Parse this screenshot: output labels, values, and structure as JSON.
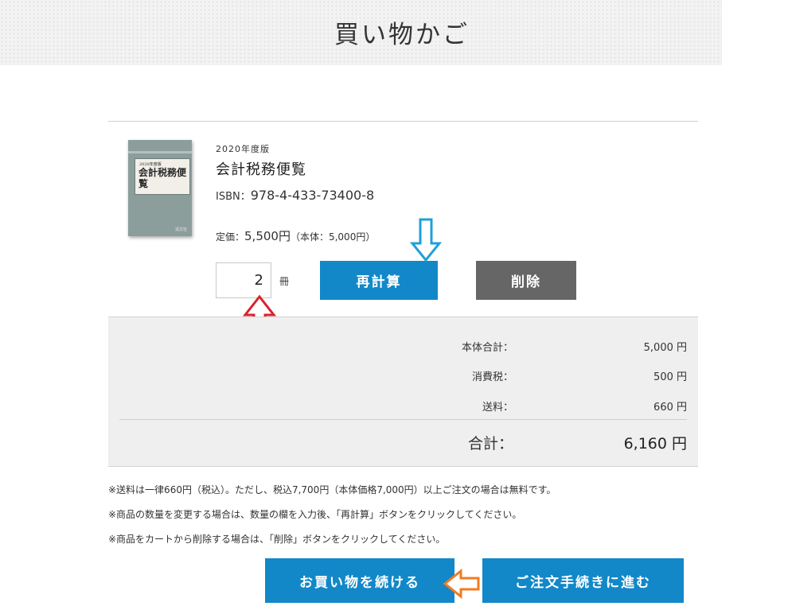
{
  "header": {
    "title": "買い物かご"
  },
  "item": {
    "cover": {
      "edition": "2020年度版",
      "title": "会計税務便覧",
      "publisher": "清文社"
    },
    "edition": "2020年度版",
    "title": "会計税務便覧",
    "isbn_label": "ISBN：",
    "isbn": "978-4-433-73400-8",
    "price_label": "定価：",
    "price": "5,500円",
    "price_note": "（本体：5,000円）",
    "quantity": "2",
    "quantity_unit": "冊",
    "recalc_label": "再計算",
    "delete_label": "削除"
  },
  "summary": {
    "rows": [
      {
        "label": "本体合計：",
        "value": "5,000 円"
      },
      {
        "label": "消費税：",
        "value": "500 円"
      },
      {
        "label": "送料：",
        "value": "660 円"
      }
    ],
    "total_label": "合計：",
    "total_value": "6,160 円"
  },
  "notes": [
    "※送料は一律660円（税込）。ただし、税込7,700円（本体価格7,000円）以上ご注文の場合は無料です。",
    "※商品の数量を変更する場合は、数量の欄を入力後、「再計算」ボタンをクリックしてください。",
    "※商品をカートから削除する場合は、「削除」ボタンをクリックしてください。"
  ],
  "actions": {
    "continue_label": "お買い物を続ける",
    "checkout_label": "ご注文手続きに進む"
  },
  "colors": {
    "accent": "#1288c8",
    "delete": "#666666",
    "annotation_blue": "#1ea0d8",
    "annotation_red": "#d9232e",
    "annotation_orange": "#f07c22"
  },
  "icons": [
    "arrow-down-annotation-icon",
    "arrow-up-annotation-icon",
    "arrow-left-annotation-icon"
  ]
}
